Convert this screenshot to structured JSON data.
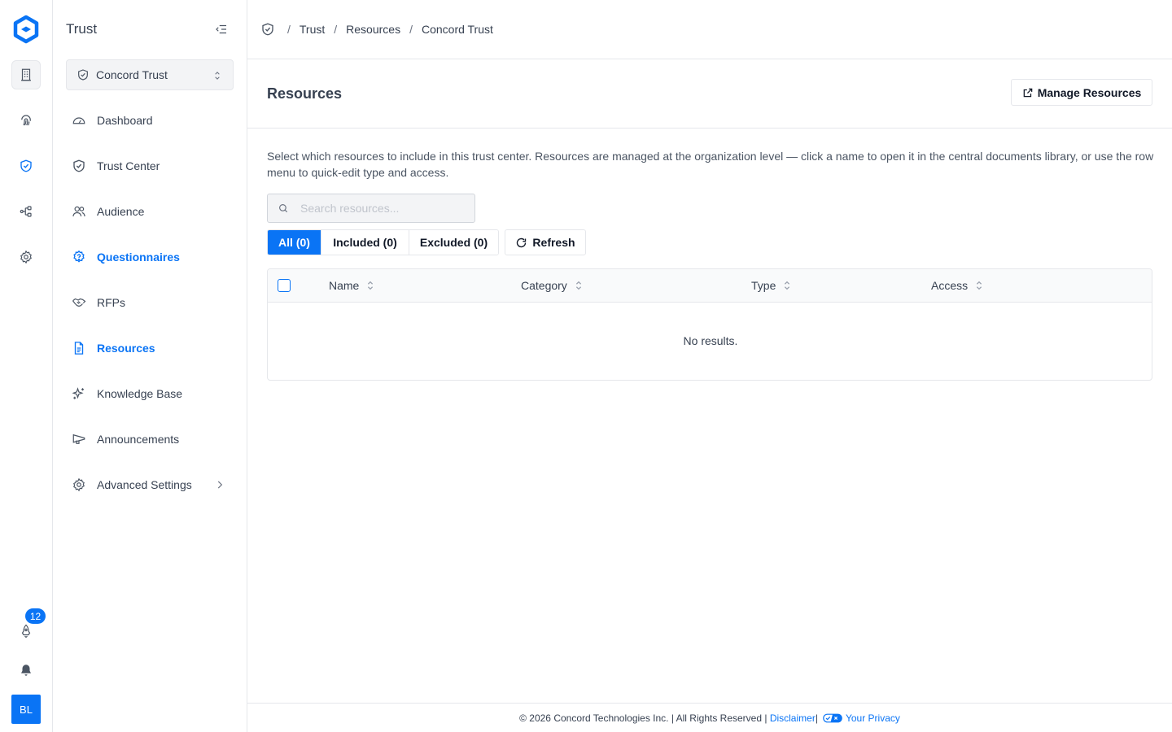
{
  "rail": {
    "items": [
      {
        "icon": "building-icon"
      },
      {
        "icon": "fingerprint-icon"
      },
      {
        "icon": "shield-check-icon"
      },
      {
        "icon": "workflow-icon"
      },
      {
        "icon": "settings-icon"
      }
    ],
    "notifications_badge": "12",
    "avatar_initials": "BL"
  },
  "sidebar": {
    "title": "Trust",
    "selector_value": "Concord Trust",
    "items": [
      {
        "label": "Dashboard",
        "icon": "gauge-icon"
      },
      {
        "label": "Trust Center",
        "icon": "shield-icon"
      },
      {
        "label": "Audience",
        "icon": "users-icon"
      },
      {
        "label": "Questionnaires",
        "icon": "question-icon"
      },
      {
        "label": "RFPs",
        "icon": "handshake-icon"
      },
      {
        "label": "Resources",
        "icon": "file-icon"
      },
      {
        "label": "Knowledge Base",
        "icon": "sparkles-icon"
      },
      {
        "label": "Announcements",
        "icon": "megaphone-icon"
      },
      {
        "label": "Advanced Settings",
        "icon": "settings-icon"
      }
    ]
  },
  "breadcrumb": [
    "Trust",
    "Resources",
    "Concord Trust"
  ],
  "page": {
    "title": "Resources",
    "manage_button": "Manage Resources",
    "description": "Select which resources to include in this trust center. Resources are managed at the organization level — click a name to open it in the central documents library, or use the row menu to quick-edit type and access.",
    "search_placeholder": "Search resources...",
    "filters": {
      "all": "All (0)",
      "included": "Included (0)",
      "excluded": "Excluded (0)"
    },
    "refresh_button": "Refresh"
  },
  "table": {
    "columns": [
      "Name",
      "Category",
      "Type",
      "Access"
    ],
    "empty_text": "No results."
  },
  "footer": {
    "copyright": "© 2026 Concord Technologies Inc. | All Rights Reserved |",
    "disclaimer": "Disclaimer",
    "privacy": "Your Privacy"
  },
  "colors": {
    "accent": "#0a74f5",
    "border": "#e5e7eb"
  }
}
